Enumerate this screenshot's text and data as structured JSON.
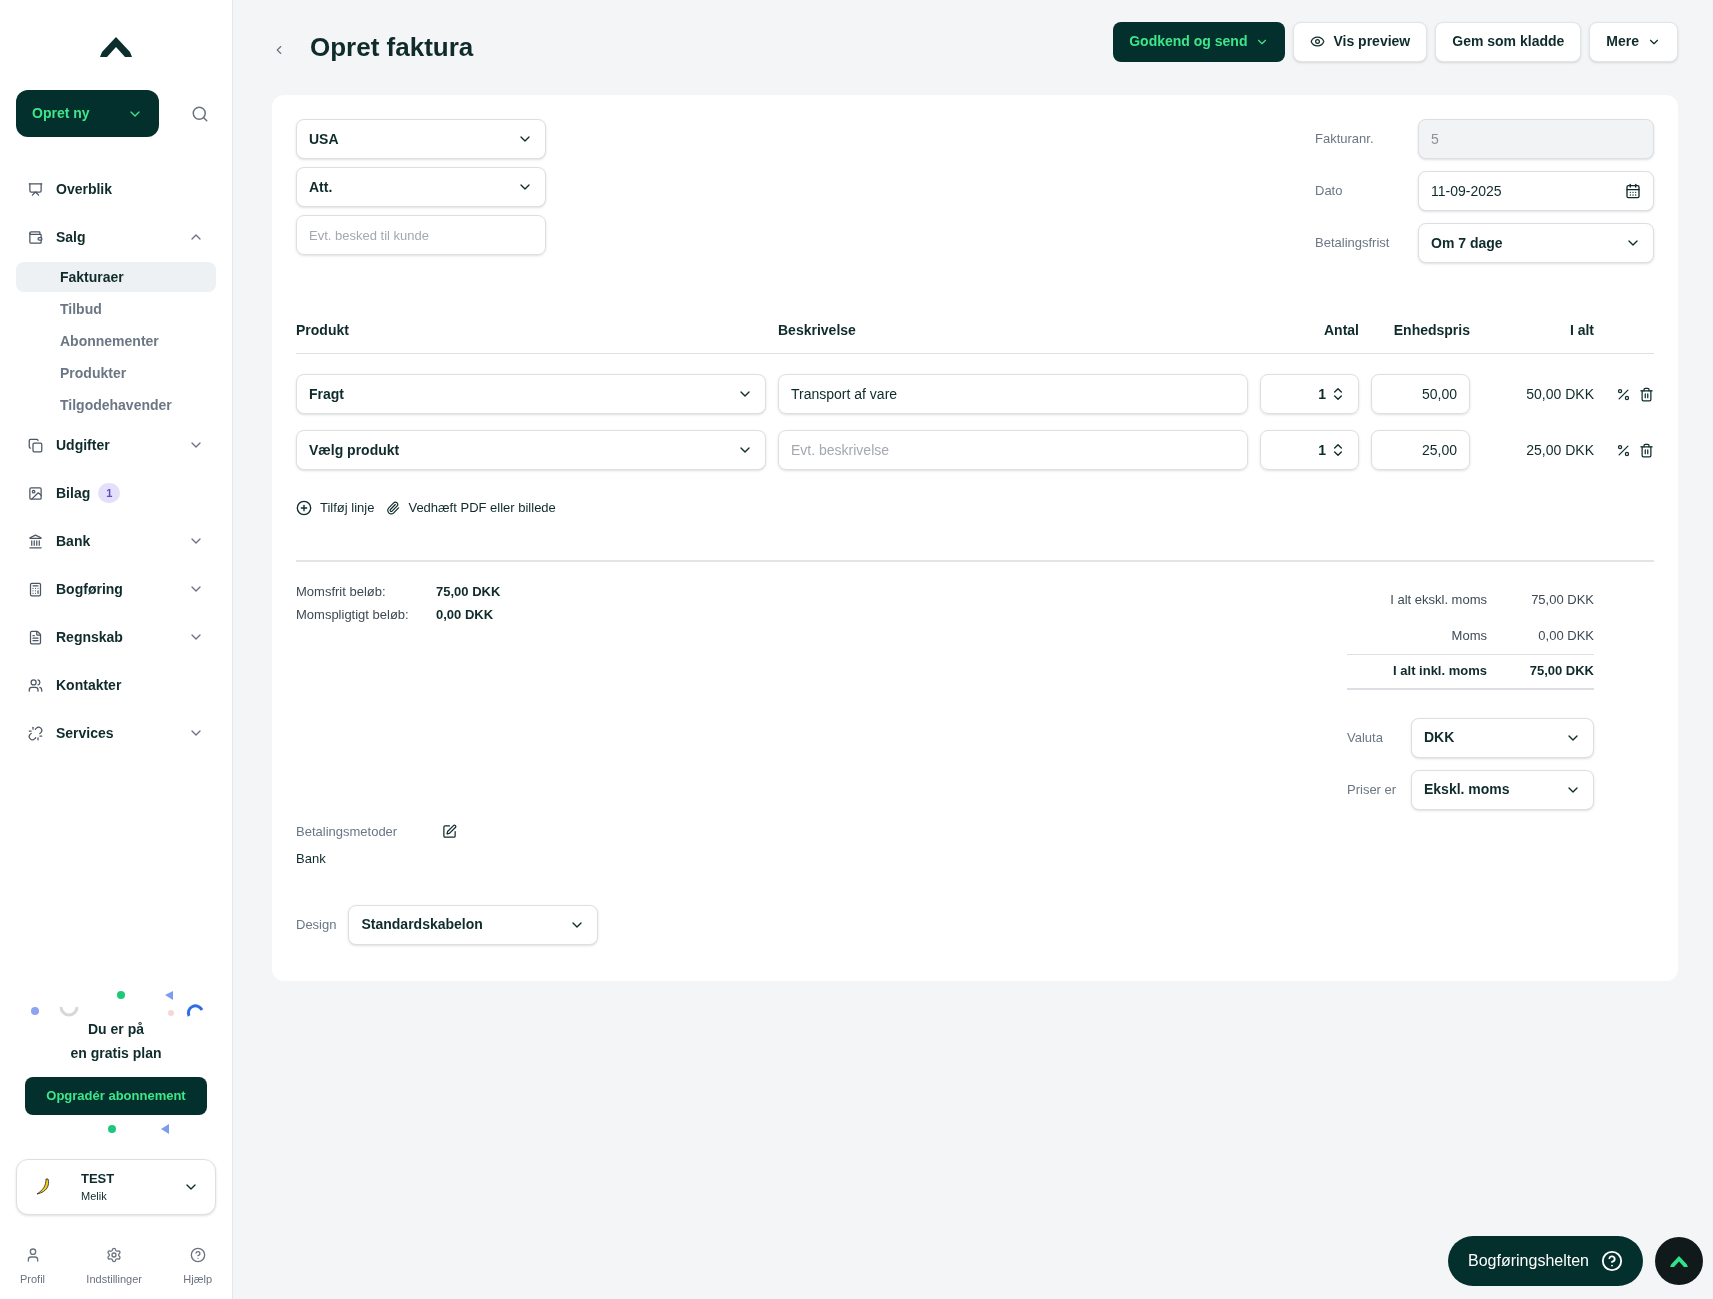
{
  "sidebar": {
    "create_button": "Opret ny",
    "nav": [
      {
        "label": "Overblik",
        "kind": "link"
      },
      {
        "label": "Salg",
        "kind": "group",
        "expanded": true,
        "children": [
          {
            "label": "Fakturaer",
            "selected": true
          },
          {
            "label": "Tilbud",
            "selected": false
          },
          {
            "label": "Abonnementer",
            "selected": false
          },
          {
            "label": "Produkter",
            "selected": false
          },
          {
            "label": "Tilgodehavender",
            "selected": false
          }
        ]
      },
      {
        "label": "Udgifter",
        "kind": "group",
        "expanded": false
      },
      {
        "label": "Bilag",
        "kind": "link",
        "badge": "1"
      },
      {
        "label": "Bank",
        "kind": "group",
        "expanded": false
      },
      {
        "label": "Bogføring",
        "kind": "group",
        "expanded": false
      },
      {
        "label": "Regnskab",
        "kind": "group",
        "expanded": false
      },
      {
        "label": "Kontakter",
        "kind": "link"
      },
      {
        "label": "Services",
        "kind": "group",
        "expanded": false
      }
    ],
    "plan": {
      "lines": [
        "Du er på",
        "en gratis plan"
      ],
      "button": "Opgradér abonnement"
    },
    "account": {
      "name": "TEST",
      "user": "Melik"
    },
    "footer": [
      "Profil",
      "Indstillinger",
      "Hjælp"
    ]
  },
  "header": {
    "title": "Opret faktura",
    "buttons": [
      {
        "label": "Godkend og send",
        "kind": "primary"
      },
      {
        "label": "Vis preview",
        "kind": "preview"
      },
      {
        "label": "Gem som kladde",
        "kind": "plain"
      },
      {
        "label": "Mere",
        "kind": "menu"
      }
    ]
  },
  "customer": {
    "country": "USA",
    "attention": "Att.",
    "message_placeholder": "Evt. besked til kunde"
  },
  "meta": [
    {
      "label": "Fakturanr.",
      "value": "5",
      "kind": "text",
      "disabled": true
    },
    {
      "label": "Dato",
      "value": "11-09-2025",
      "kind": "date",
      "disabled": false
    },
    {
      "label": "Betalingsfrist",
      "value": "Om 7 dage",
      "kind": "select",
      "disabled": false
    }
  ],
  "table": {
    "columns": [
      "Produkt",
      "Beskrivelse",
      "Antal",
      "Enhedspris",
      "I alt"
    ],
    "rows": [
      {
        "product": "Fragt",
        "description": "Transport af vare",
        "quantity": "1",
        "unit_price": "50,00",
        "total": "50,00 DKK"
      },
      {
        "product": "Vælg produkt",
        "description_placeholder": "Evt. beskrivelse",
        "quantity": "1",
        "unit_price": "25,00",
        "total": "25,00 DKK"
      }
    ]
  },
  "actions": [
    "Tilføj linje",
    "Vedhæft PDF eller billede"
  ],
  "vat": [
    {
      "label": "Momsfrit beløb:",
      "value": "75,00 DKK"
    },
    {
      "label": "Momspligtigt beløb:",
      "value": "0,00 DKK"
    }
  ],
  "totals": [
    {
      "label": "I alt ekskl. moms",
      "value": "75,00 DKK",
      "kind": "line"
    },
    {
      "label": "Moms",
      "value": "0,00 DKK",
      "kind": "line"
    },
    {
      "label": "I alt inkl. moms",
      "value": "75,00 DKK",
      "kind": "total"
    }
  ],
  "settings": [
    {
      "label": "Valuta",
      "value": "DKK"
    },
    {
      "label": "Priser er",
      "value": "Ekskl. moms"
    }
  ],
  "payment": {
    "label": "Betalingsmetoder",
    "value": "Bank"
  },
  "design": {
    "label": "Design",
    "value": "Standardskabelon"
  },
  "helper": {
    "label": "Bogføringshelten"
  }
}
